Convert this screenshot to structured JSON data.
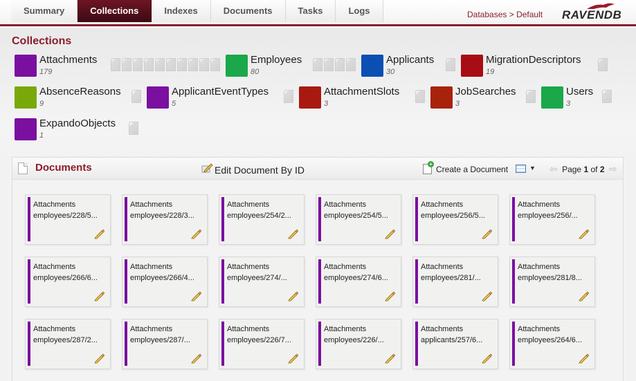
{
  "tabs": [
    "Summary",
    "Collections",
    "Indexes",
    "Documents",
    "Tasks",
    "Logs"
  ],
  "active_tab": "Collections",
  "breadcrumb": {
    "root": "Databases",
    "separator": ">",
    "current": "Default"
  },
  "logo": {
    "text": "RAVENDB"
  },
  "collections_title": "Collections",
  "collections": [
    {
      "name": "Attachments",
      "count": "179",
      "color": "#7a0fa0",
      "page_icons": 10
    },
    {
      "name": "Employees",
      "count": "80",
      "color": "#1aa84a",
      "page_icons": 4
    },
    {
      "name": "Applicants",
      "count": "30",
      "color": "#0b4fb3",
      "page_icons": 1
    },
    {
      "name": "MigrationDescriptors",
      "count": "19",
      "color": "#a80c14",
      "page_icons": 1
    },
    {
      "name": "AbsenceReasons",
      "count": "9",
      "color": "#79a80a",
      "page_icons": 1
    },
    {
      "name": "ApplicantEventTypes",
      "count": "5",
      "color": "#7a0fa0",
      "page_icons": 1
    },
    {
      "name": "AttachmentSlots",
      "count": "3",
      "color": "#a81a10",
      "page_icons": 1
    },
    {
      "name": "JobSearches",
      "count": "3",
      "color": "#a8220c",
      "page_icons": 1
    },
    {
      "name": "Users",
      "count": "3",
      "color": "#1aa84a",
      "page_icons": 1
    },
    {
      "name": "ExpandoObjects",
      "count": "1",
      "color": "#7a0fa0",
      "page_icons": 1
    }
  ],
  "documents_panel": {
    "title": "Documents",
    "edit_by_id": "Edit Document By ID",
    "create_document": "Create a Document",
    "pager": {
      "label": "Page",
      "current": "1",
      "of": "of",
      "total": "2"
    }
  },
  "documents": [
    {
      "collection": "Attachments",
      "id": "employees/228/5..."
    },
    {
      "collection": "Attachments",
      "id": "employees/228/3..."
    },
    {
      "collection": "Attachments",
      "id": "employees/254/2..."
    },
    {
      "collection": "Attachments",
      "id": "employees/254/5..."
    },
    {
      "collection": "Attachments",
      "id": "employees/256/5..."
    },
    {
      "collection": "Attachments",
      "id": "employees/256/..."
    },
    {
      "collection": "Attachments",
      "id": "employees/266/6..."
    },
    {
      "collection": "Attachments",
      "id": "employees/266/4..."
    },
    {
      "collection": "Attachments",
      "id": "employees/274/..."
    },
    {
      "collection": "Attachments",
      "id": "employees/274/6..."
    },
    {
      "collection": "Attachments",
      "id": "employees/281/..."
    },
    {
      "collection": "Attachments",
      "id": "employees/281/8..."
    },
    {
      "collection": "Attachments",
      "id": "employees/287/2..."
    },
    {
      "collection": "Attachments",
      "id": "employees/287/..."
    },
    {
      "collection": "Attachments",
      "id": "employees/226/7..."
    },
    {
      "collection": "Attachments",
      "id": "employees/226/..."
    },
    {
      "collection": "Attachments",
      "id": "applicants/257/6..."
    },
    {
      "collection": "Attachments",
      "id": "employees/264/6..."
    }
  ],
  "doc_bar_color": "#7a0fa0",
  "icons": {
    "edit_by_id": "pencil-page-icon",
    "create_document": "new-page-icon",
    "view_toggle": "list-view-icon",
    "doc_edit": "pencil-icon"
  }
}
